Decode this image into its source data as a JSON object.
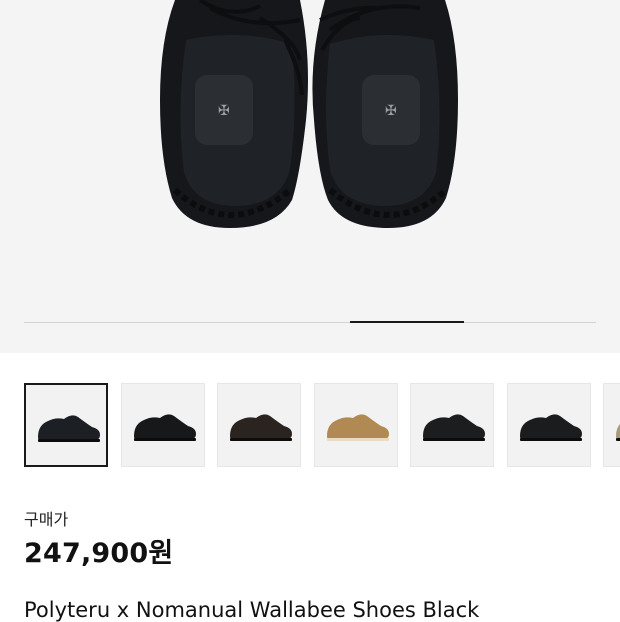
{
  "gallery": {
    "progress_fraction": 0.2,
    "progress_position": 0.6,
    "thumbnails": [
      {
        "color": "#1c1f24",
        "kind": "shoe-thumb"
      },
      {
        "color": "#17181a",
        "kind": "shoe-thumb"
      },
      {
        "color": "#2a2320",
        "kind": "shoe-thumb"
      },
      {
        "color": "#b08a52",
        "kind": "shoe-thumb"
      },
      {
        "color": "#1b1d1f",
        "kind": "shoe-thumb"
      },
      {
        "color": "#1a1c1e",
        "kind": "shoe-thumb"
      },
      {
        "color": "#a89a7c",
        "kind": "shoe-thumb"
      }
    ],
    "active_index": 0
  },
  "product": {
    "price_label": "구매가",
    "price": "247,900원",
    "title": "Polyteru x Nomanual Wallabee Shoes Black"
  },
  "colors": {
    "hero_background": "#f4f4f4",
    "shoe": "#15171a",
    "insole_badge": "#2b2e33"
  }
}
